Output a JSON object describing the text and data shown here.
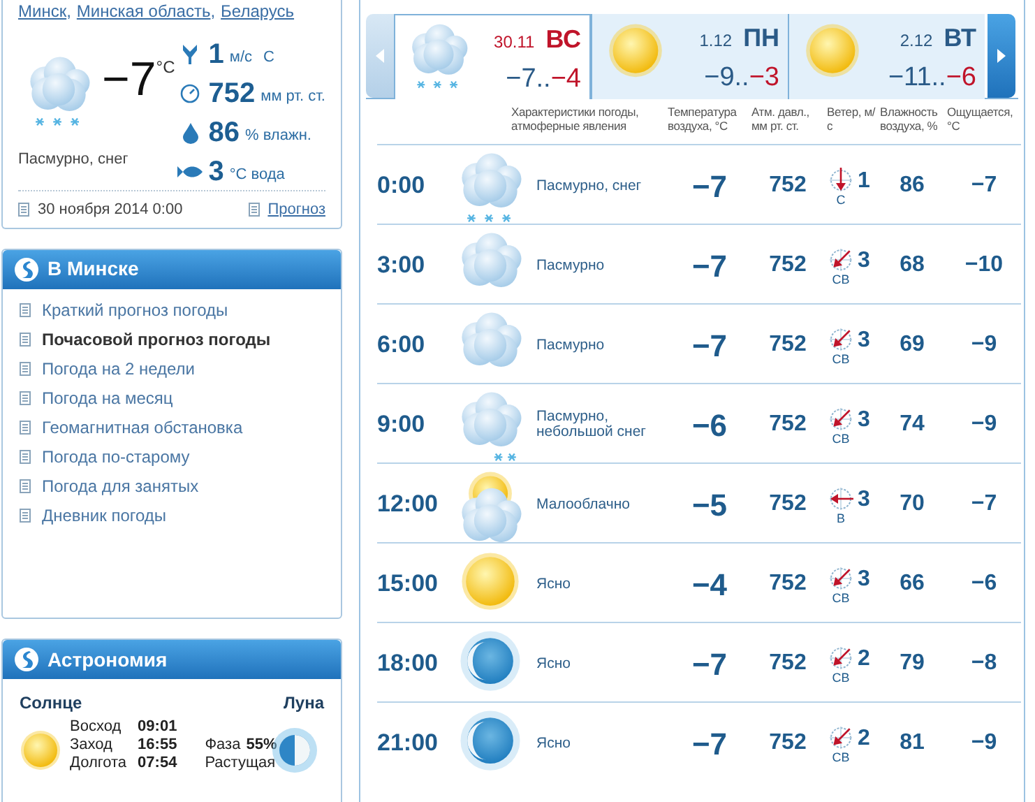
{
  "location": [
    {
      "label": "Минск",
      "separator": ","
    },
    {
      "label": "Минская область",
      "separator": ","
    },
    {
      "label": "Беларусь"
    }
  ],
  "current": {
    "kind": "snow",
    "temperature": "−7",
    "unit": "°C",
    "condition": "Пасмурно, снег",
    "stats": [
      {
        "kind": "wind",
        "value": "1",
        "unit": "м/с",
        "direction": "С"
      },
      {
        "kind": "pressure",
        "value": "752",
        "unit": "мм рт. ст."
      },
      {
        "kind": "humidity",
        "value": "86",
        "unit": "% влажн."
      },
      {
        "kind": "water",
        "value": "3",
        "unit": "°C вода"
      }
    ],
    "date": "30 ноября 2014 0:00",
    "forecast_link": "Прогноз"
  },
  "city_menu": {
    "title": "В Минске",
    "items": [
      {
        "label": "Краткий прогноз погоды",
        "selected": false
      },
      {
        "label": "Почасовой прогноз погоды",
        "selected": true
      },
      {
        "label": "Погода на 2 недели",
        "selected": false
      },
      {
        "label": "Погода на месяц",
        "selected": false
      },
      {
        "label": "Геомагнитная обстановка",
        "selected": false
      },
      {
        "label": "Погода по-старому",
        "selected": false
      },
      {
        "label": "Погода для занятых",
        "selected": false
      },
      {
        "label": "Дневник погоды",
        "selected": false
      }
    ]
  },
  "astronomy": {
    "title": "Астрономия",
    "sun_label": "Солнце",
    "moon_label": "Луна",
    "sun_rows": [
      {
        "label": "Восход",
        "value": "09:01"
      },
      {
        "label": "Заход",
        "value": "16:55"
      },
      {
        "label": "Долгота",
        "value": "07:54"
      }
    ],
    "phase_label": "Фаза",
    "phase_value": "55%",
    "phase_name": "Растущая"
  },
  "days": [
    {
      "kind": "snow",
      "date": "30.11",
      "day": "ВС",
      "weekend": true,
      "low": "−7..",
      "high": "−4",
      "selected": true
    },
    {
      "kind": "clear",
      "date": "1.12",
      "day": "ПН",
      "weekend": false,
      "low": "−9..",
      "high": "−3",
      "selected": false
    },
    {
      "kind": "clear",
      "date": "2.12",
      "day": "ВТ",
      "weekend": false,
      "low": "−11..",
      "high": "−6",
      "selected": false
    }
  ],
  "columns": [
    "Характеристики погоды, атмоферные явления",
    "Температура воздуха, °C",
    "Атм. давл., мм рт. ст.",
    "Ветер, м/с",
    "Влажность воздуха, %",
    "Ощущается, °C"
  ],
  "rows": [
    {
      "time": "0:00",
      "kind": "snow",
      "condition": "Пасмурно, снег",
      "temperature": "−7",
      "pressure": "752",
      "wind": {
        "kind": "n",
        "direction": "С",
        "speed": "1"
      },
      "humidity": "86",
      "feels_like": "−7"
    },
    {
      "time": "3:00",
      "kind": "overcast",
      "condition": "Пасмурно",
      "temperature": "−7",
      "pressure": "752",
      "wind": {
        "kind": "ne",
        "direction": "СВ",
        "speed": "3"
      },
      "humidity": "68",
      "feels_like": "−10"
    },
    {
      "time": "6:00",
      "kind": "overcast",
      "condition": "Пасмурно",
      "temperature": "−7",
      "pressure": "752",
      "wind": {
        "kind": "ne",
        "direction": "СВ",
        "speed": "3"
      },
      "humidity": "69",
      "feels_like": "−9"
    },
    {
      "time": "9:00",
      "kind": "light_snow",
      "condition": "Пасмурно, небольшой снег",
      "temperature": "−6",
      "pressure": "752",
      "wind": {
        "kind": "ne",
        "direction": "СВ",
        "speed": "3"
      },
      "humidity": "74",
      "feels_like": "−9"
    },
    {
      "time": "12:00",
      "kind": "partly_cloudy",
      "condition": "Малооблачно",
      "temperature": "−5",
      "pressure": "752",
      "wind": {
        "kind": "e",
        "direction": "В",
        "speed": "3"
      },
      "humidity": "70",
      "feels_like": "−7"
    },
    {
      "time": "15:00",
      "kind": "clear",
      "condition": "Ясно",
      "temperature": "−4",
      "pressure": "752",
      "wind": {
        "kind": "ne",
        "direction": "СВ",
        "speed": "3"
      },
      "humidity": "66",
      "feels_like": "−6"
    },
    {
      "time": "18:00",
      "kind": "night_clear",
      "condition": "Ясно",
      "temperature": "−7",
      "pressure": "752",
      "wind": {
        "kind": "ne",
        "direction": "СВ",
        "speed": "2"
      },
      "humidity": "79",
      "feels_like": "−8"
    },
    {
      "time": "21:00",
      "kind": "night_clear",
      "condition": "Ясно",
      "temperature": "−7",
      "pressure": "752",
      "wind": {
        "kind": "ne",
        "direction": "СВ",
        "speed": "2"
      },
      "humidity": "81",
      "feels_like": "−9"
    }
  ]
}
